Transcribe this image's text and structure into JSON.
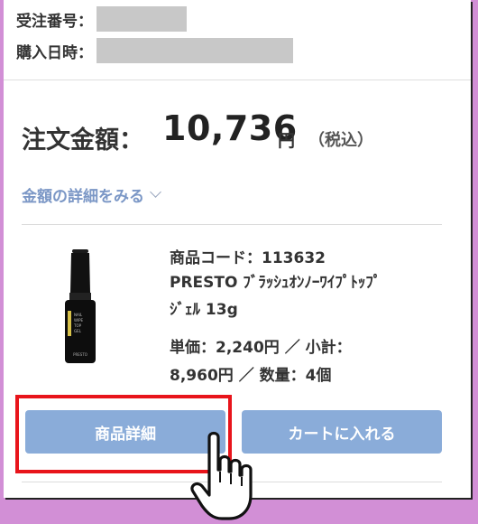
{
  "header": {
    "order_number_label": "受注番号：",
    "purchase_date_label": "購入日時："
  },
  "order": {
    "total_label": "注文金額：",
    "total_value": "10,736",
    "total_unit": "円",
    "tax_note": "（税込）",
    "detail_link": "金額の詳細をみる"
  },
  "product": {
    "code_line": "商品コード：113632",
    "name_line1": "PRESTO ﾌﾞﾗｯｼｭｵﾝﾉｰﾜｲﾌﾟﾄｯﾌﾟ",
    "name_line2": "ｼﾞｪﾙ 13g",
    "price_line1": "単価：2,240円 ／ 小計：",
    "price_line2": "8,960円 ／ 数量：4個",
    "bottle_label": "PRESTO"
  },
  "buttons": {
    "product_detail": "商品詳細",
    "add_to_cart": "カートに入れる"
  },
  "colors": {
    "button": "#8aacd9",
    "link": "#7b97c6",
    "highlight": "#e8141b",
    "background": "#d28fd6"
  },
  "icons": {
    "pointer": "hand-pointer-icon",
    "chevron": "chevron-down-icon"
  }
}
